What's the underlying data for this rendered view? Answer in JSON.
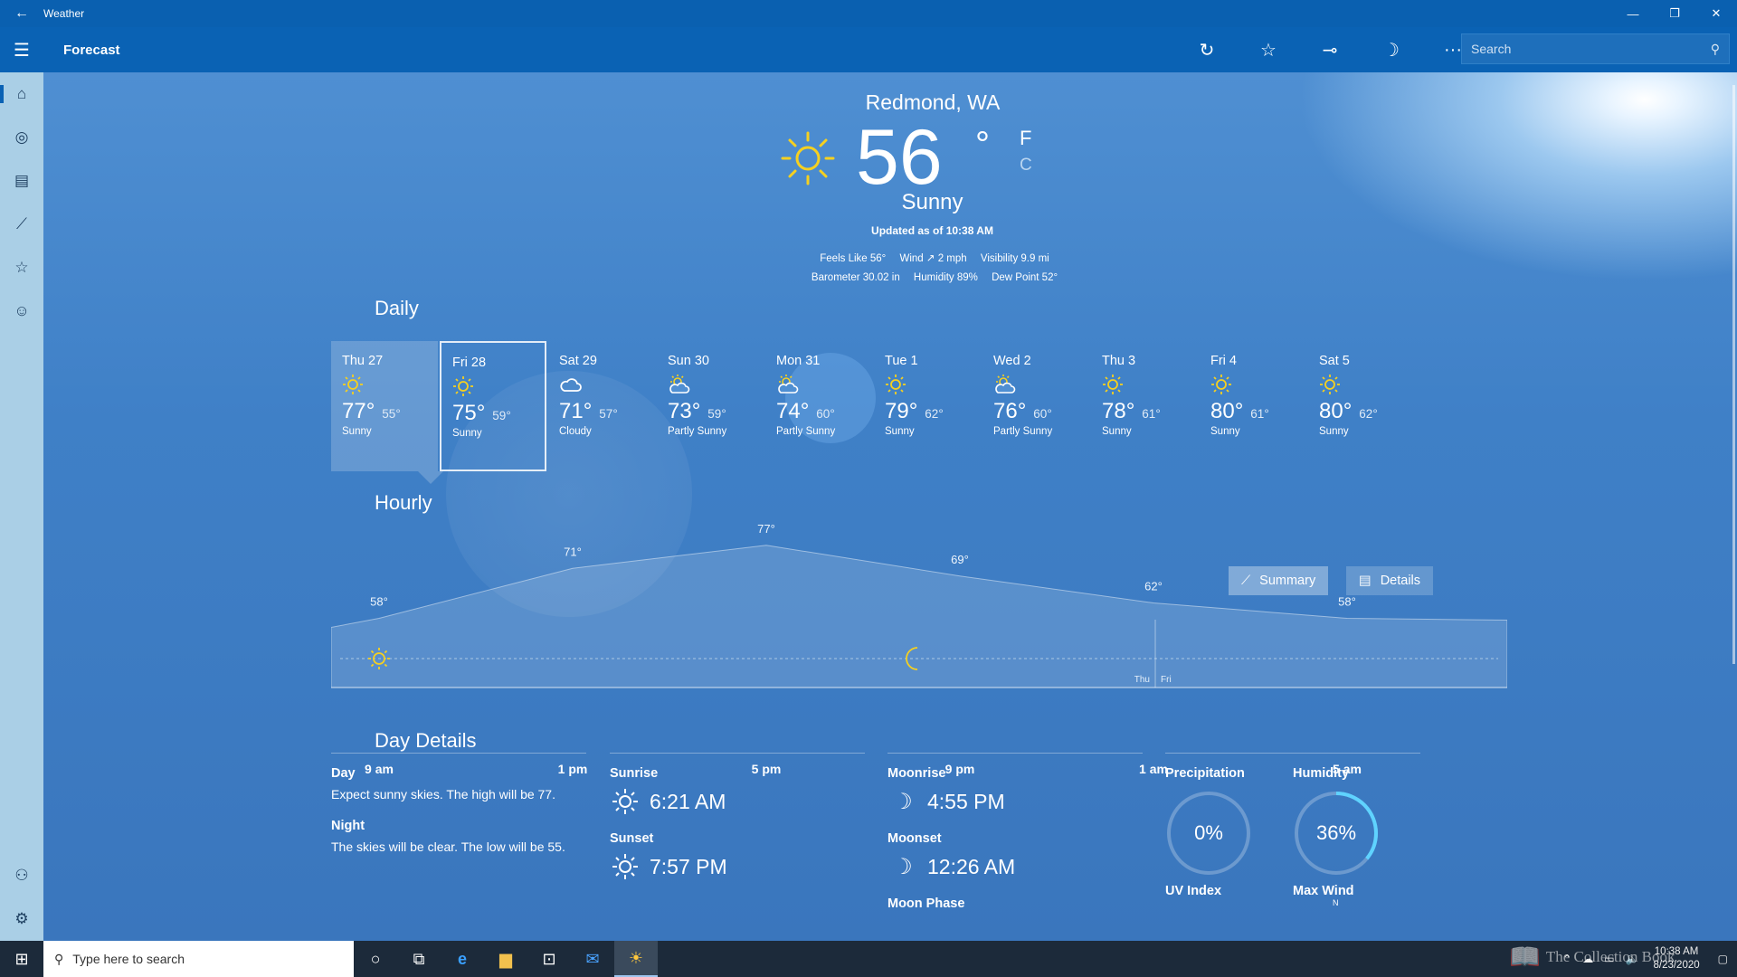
{
  "window": {
    "title": "Weather"
  },
  "app": {
    "page_title": "Forecast",
    "search_placeholder": "Search"
  },
  "current": {
    "location": "Redmond, WA",
    "temp": "56",
    "deg": "°",
    "unit_f": "F",
    "unit_c": "C",
    "condition": "Sunny",
    "updated": "Updated as of 10:38 AM",
    "feels_like": "Feels Like  56°",
    "wind": "Wind  ↗ 2 mph",
    "visibility": "Visibility  9.9 mi",
    "barometer": "Barometer  30.02 in",
    "humidity": "Humidity  89%",
    "dew_point": "Dew Point  52°"
  },
  "daily": {
    "title": "Daily",
    "days": [
      {
        "name": "Thu 27",
        "hi": "77°",
        "lo": "55°",
        "cond": "Sunny",
        "icon": "sun"
      },
      {
        "name": "Fri 28",
        "hi": "75°",
        "lo": "59°",
        "cond": "Sunny",
        "icon": "sun"
      },
      {
        "name": "Sat 29",
        "hi": "71°",
        "lo": "57°",
        "cond": "Cloudy",
        "icon": "cloud"
      },
      {
        "name": "Sun 30",
        "hi": "73°",
        "lo": "59°",
        "cond": "Partly Sunny",
        "icon": "partly-sunny"
      },
      {
        "name": "Mon 31",
        "hi": "74°",
        "lo": "60°",
        "cond": "Partly Sunny",
        "icon": "partly-sunny"
      },
      {
        "name": "Tue 1",
        "hi": "79°",
        "lo": "62°",
        "cond": "Sunny",
        "icon": "sun"
      },
      {
        "name": "Wed 2",
        "hi": "76°",
        "lo": "60°",
        "cond": "Partly Sunny",
        "icon": "partly-sunny"
      },
      {
        "name": "Thu 3",
        "hi": "78°",
        "lo": "61°",
        "cond": "Sunny",
        "icon": "sun"
      },
      {
        "name": "Fri 4",
        "hi": "80°",
        "lo": "61°",
        "cond": "Sunny",
        "icon": "sun"
      },
      {
        "name": "Sat 5",
        "hi": "80°",
        "lo": "62°",
        "cond": "Sunny",
        "icon": "sun"
      }
    ]
  },
  "hourly": {
    "title": "Hourly",
    "summary_label": "Summary",
    "details_label": "Details",
    "day_split": [
      "Thu",
      "Fri"
    ]
  },
  "chart_data": {
    "type": "area",
    "x": [
      "9 am",
      "1 pm",
      "5 pm",
      "9 pm",
      "1 am",
      "5 am"
    ],
    "labels": [
      "58°",
      "71°",
      "77°",
      "69°",
      "62°",
      "58°"
    ],
    "values": [
      58,
      71,
      77,
      69,
      62,
      58
    ],
    "ylabel": "",
    "xlabel": ""
  },
  "day_details": {
    "title": "Day Details",
    "day_label": "Day",
    "day_text": "Expect sunny skies. The high will be 77.",
    "night_label": "Night",
    "night_text": "The skies will be clear. The low will be 55.",
    "sunrise_label": "Sunrise",
    "sunrise": "6:21 AM",
    "sunset_label": "Sunset",
    "sunset": "7:57 PM",
    "moonrise_label": "Moonrise",
    "moonrise": "4:55 PM",
    "moonset_label": "Moonset",
    "moonset": "12:26 AM",
    "moonphase_label": "Moon Phase",
    "precip_label": "Precipitation",
    "precip": "0%",
    "precip_frac": 0,
    "humidity_label": "Humidity",
    "humidity": "36%",
    "humidity_frac": 0.36,
    "uv_label": "UV Index",
    "maxwind_label": "Max Wind",
    "maxwind_dir": "N"
  },
  "taskbar": {
    "search_placeholder": "Type here to search",
    "time": "10:38 AM",
    "date": "8/23/2020"
  },
  "watermark": "The Collection Book",
  "colors": {
    "accent": "#0a62b4",
    "sun": "#f5d020",
    "nav": "#aacfe6",
    "ring": "#5fd3ff"
  }
}
